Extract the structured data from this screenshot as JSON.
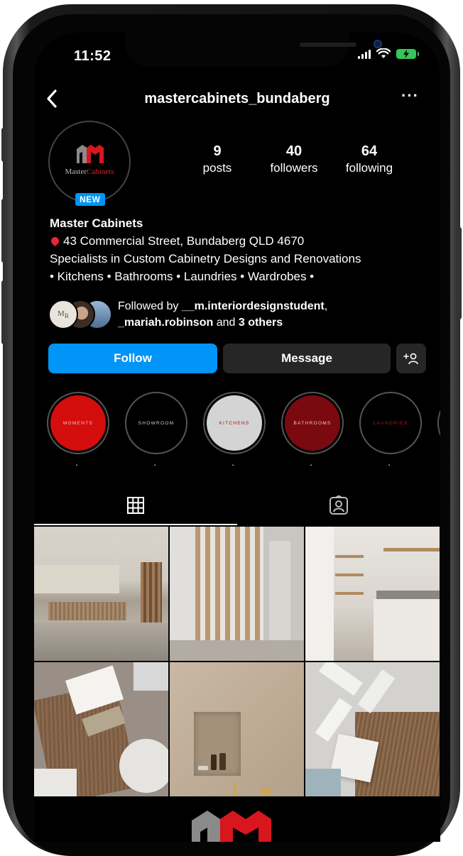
{
  "status_bar": {
    "time": "11:52"
  },
  "header": {
    "back_icon": "chevron-left-icon",
    "username": "mastercabinets_bundaberg",
    "more_label": "···"
  },
  "profile": {
    "avatar_logo_part1": "Master",
    "avatar_logo_part2": "Cabinets",
    "new_badge": "NEW",
    "stats": [
      {
        "value": "9",
        "label": "posts"
      },
      {
        "value": "40",
        "label": "followers"
      },
      {
        "value": "64",
        "label": "following"
      }
    ],
    "name": "Master Cabinets",
    "address": "43 Commercial Street, Bundaberg QLD 4670",
    "bio_line1": "Specialists in Custom Cabinetry Designs and Renovations",
    "bio_line2": "• Kitchens • Bathrooms • Laundries • Wardrobes •",
    "followed_by": {
      "prefix": "Followed by ",
      "user1": "__m.interiordesignstudent",
      "comma": ",",
      "user2": "_mariah.robinson",
      "and": " and ",
      "others": "3 others"
    }
  },
  "actions": {
    "follow": "Follow",
    "message": "Message",
    "add_person": "+⚉"
  },
  "highlights": [
    {
      "cover_text": "MOMENTS",
      "label": ".",
      "bg": "#d40d0d",
      "fg": "#f1c0c0"
    },
    {
      "cover_text": "SHOWROOM",
      "label": ".",
      "bg": "#000000",
      "fg": "#cfcfcf"
    },
    {
      "cover_text": "KITCHENS",
      "label": ".",
      "bg": "#d4d4d4",
      "fg": "#a81010"
    },
    {
      "cover_text": "BATHROOMS",
      "label": ".",
      "bg": "#7a0a10",
      "fg": "#f0c8c8"
    },
    {
      "cover_text": "LAUNDRIES",
      "label": ".",
      "bg": "#000000",
      "fg": "#c0141c"
    }
  ],
  "tabs": {
    "grid_icon": "grid-icon",
    "tagged_icon": "tagged-person-icon"
  },
  "posts": [
    {
      "subject": "kitchen-island-photo"
    },
    {
      "subject": "timber-slat-screen-photo"
    },
    {
      "subject": "laundry-cabinetry-photo"
    },
    {
      "subject": "material-samples-flatlay-photo"
    },
    {
      "subject": "bathroom-niche-photo"
    },
    {
      "subject": "tile-and-timber-samples-photo"
    }
  ],
  "colors": {
    "accent": "#0095f6",
    "brand_red": "#d7161e",
    "background": "#000000",
    "button_dark": "#262626"
  }
}
